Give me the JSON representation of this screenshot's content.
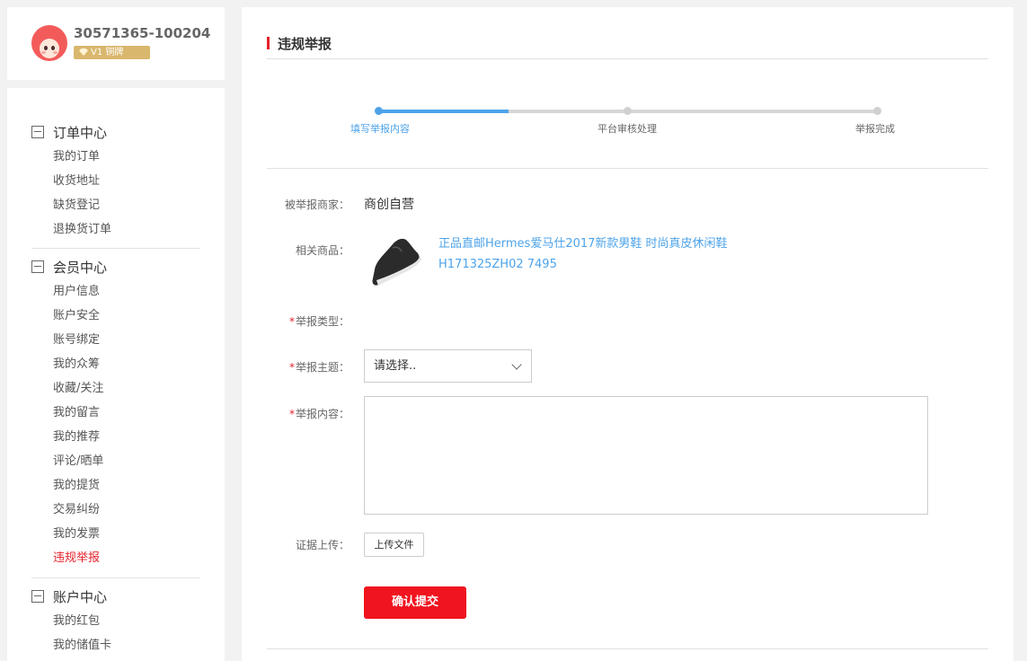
{
  "user": {
    "id": "30571365-100204",
    "level": "V1 铜牌"
  },
  "sidebar": {
    "groups": [
      {
        "title": "订单中心",
        "items": [
          "我的订单",
          "收货地址",
          "缺货登记",
          "退换货订单"
        ]
      },
      {
        "title": "会员中心",
        "items": [
          "用户信息",
          "账户安全",
          "账号绑定",
          "我的众筹",
          "收藏/关注",
          "我的留言",
          "我的推荐",
          "评论/晒单",
          "我的提货",
          "交易纠纷",
          "我的发票",
          "违规举报"
        ]
      },
      {
        "title": "账户中心",
        "items": [
          "我的红包",
          "我的储值卡"
        ]
      }
    ],
    "active_item": "违规举报"
  },
  "page": {
    "title": "违规举报"
  },
  "steps": {
    "items": [
      "填写举报内容",
      "平台审核处理",
      "举报完成"
    ],
    "current": 1,
    "progress": 0.26
  },
  "form": {
    "merchant_label": "被举报商家：",
    "merchant_value": "商创自营",
    "product_label": "相关商品：",
    "product_title": "正品直邮Hermes爱马仕2017新款男鞋 时尚真皮休闲鞋 H171325ZH02 7495",
    "type_label": "举报类型：",
    "subject_label": "举报主题：",
    "subject_placeholder": "请选择..",
    "content_label": "举报内容：",
    "evidence_label": "证据上传：",
    "upload_button": "上传文件",
    "submit_button": "确认提交"
  },
  "colors": {
    "accent_red": "#e5212b",
    "link_blue": "#4da3ea",
    "vip_gold": "#d9b76c"
  }
}
